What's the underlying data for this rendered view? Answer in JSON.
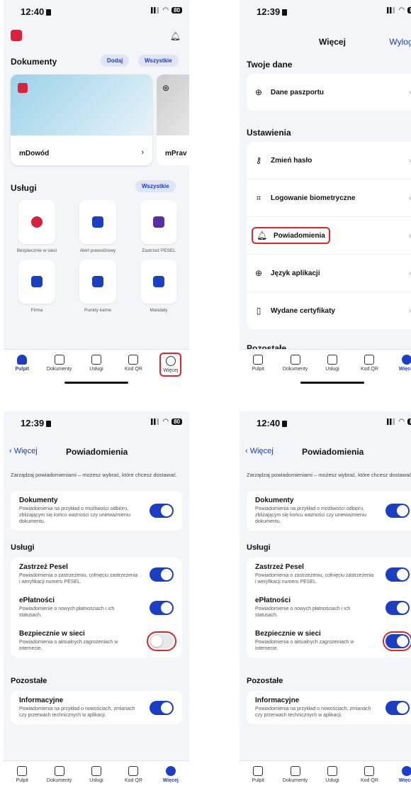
{
  "p1": {
    "time": "12:40",
    "battery": "80",
    "documents_title": "Dokumenty",
    "add_label": "Dodaj",
    "all_label": "Wszystkie",
    "card1_name": "mDowód",
    "card2_name": "mPrav",
    "services_title": "Usługi",
    "services_all": "Wszystkie",
    "tiles": [
      {
        "label": "Bezpiecznie w sieci",
        "color": "#d81f3c"
      },
      {
        "label": "Alert powodziowy",
        "color": "#1a3fc4"
      },
      {
        "label": "Zastrzeż PESEL",
        "color": "#5b2ea8"
      },
      {
        "label": "Firma",
        "color": "#1a3fc4"
      },
      {
        "label": "Punkty karne",
        "color": "#1a3fc4"
      },
      {
        "label": "Mandaty",
        "color": "#1a3fc4"
      }
    ]
  },
  "tabs": [
    "Pulpit",
    "Dokumenty",
    "Usługi",
    "Kod QR",
    "Więcej"
  ],
  "p2": {
    "time": "12:39",
    "title": "Więcej",
    "logout": "Wyloguj",
    "your_data": "Twoje dane",
    "passport": "Dane paszportu",
    "settings": "Ustawienia",
    "rows": [
      "Zmień hasło",
      "Logowanie biometryczne",
      "Powiadomienia",
      "Język aplikacji",
      "Wydane certyfikaty"
    ],
    "other": "Pozostałe"
  },
  "notif": {
    "time_left": "12:39",
    "time_right": "12:40",
    "back": "Więcej",
    "title": "Powiadomienia",
    "intro": "Zarządzaj powiadomieniami – możesz wybrać, które chcesz dostawać.",
    "docs_title": "Dokumenty",
    "docs_desc": "Powiadomienia na przykład o możliwości odbioru, zbliżającym się końcu ważności czy unieważnieniu dokumentu.",
    "services": "Usługi",
    "pesel_title": "Zastrzeż Pesel",
    "pesel_desc": "Powiadomienia o zastrzeżeniu, cofnięciu zastrzeżenia i weryfikacji numeru PESEL.",
    "epay_title": "ePłatności",
    "epay_desc": "Powiadomienie o nowych płatnościach i ich statusach.",
    "safe_title": "Bezpiecznie w sieci",
    "safe_desc": "Powiadomienia o aktualnych zagrożeniach w internecie.",
    "other": "Pozostałe",
    "info_title": "Informacyjne",
    "info_desc": "Powiadomienia na przykład o nowościach, zmianach czy przerwach technicznych w aplikacji."
  }
}
